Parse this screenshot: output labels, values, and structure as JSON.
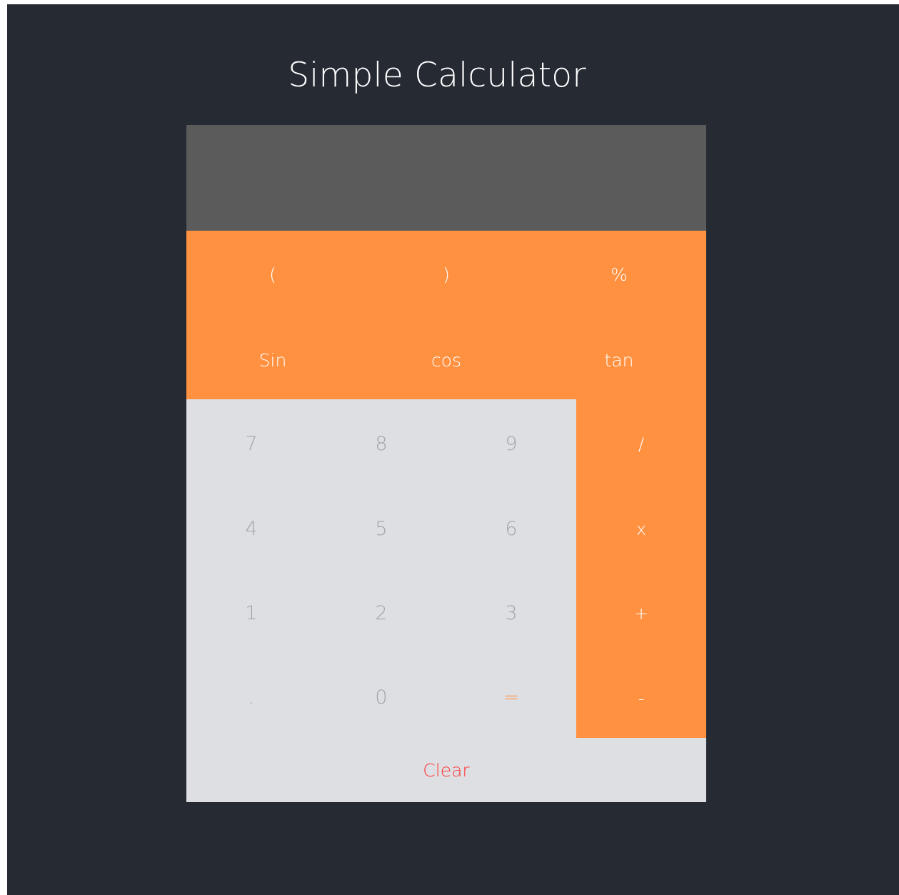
{
  "app": {
    "title": "Simple Calculator"
  },
  "display": {
    "value": ""
  },
  "function_rows": [
    [
      "(",
      ")",
      "%"
    ],
    [
      "Sin",
      "cos",
      "tan"
    ]
  ],
  "number_rows": [
    [
      "7",
      "8",
      "9"
    ],
    [
      "4",
      "5",
      "6"
    ],
    [
      "1",
      "2",
      "3"
    ],
    [
      ".",
      "0",
      "="
    ]
  ],
  "operators": [
    "/",
    "x",
    "+",
    "-"
  ],
  "clear": "Clear",
  "colors": {
    "background": "#252a33",
    "display": "#5b5b5b",
    "accent": "#ff9140",
    "keypad": "#dedfe3",
    "number_text": "#a5a5a8",
    "clear_text": "#ff3a3a"
  }
}
